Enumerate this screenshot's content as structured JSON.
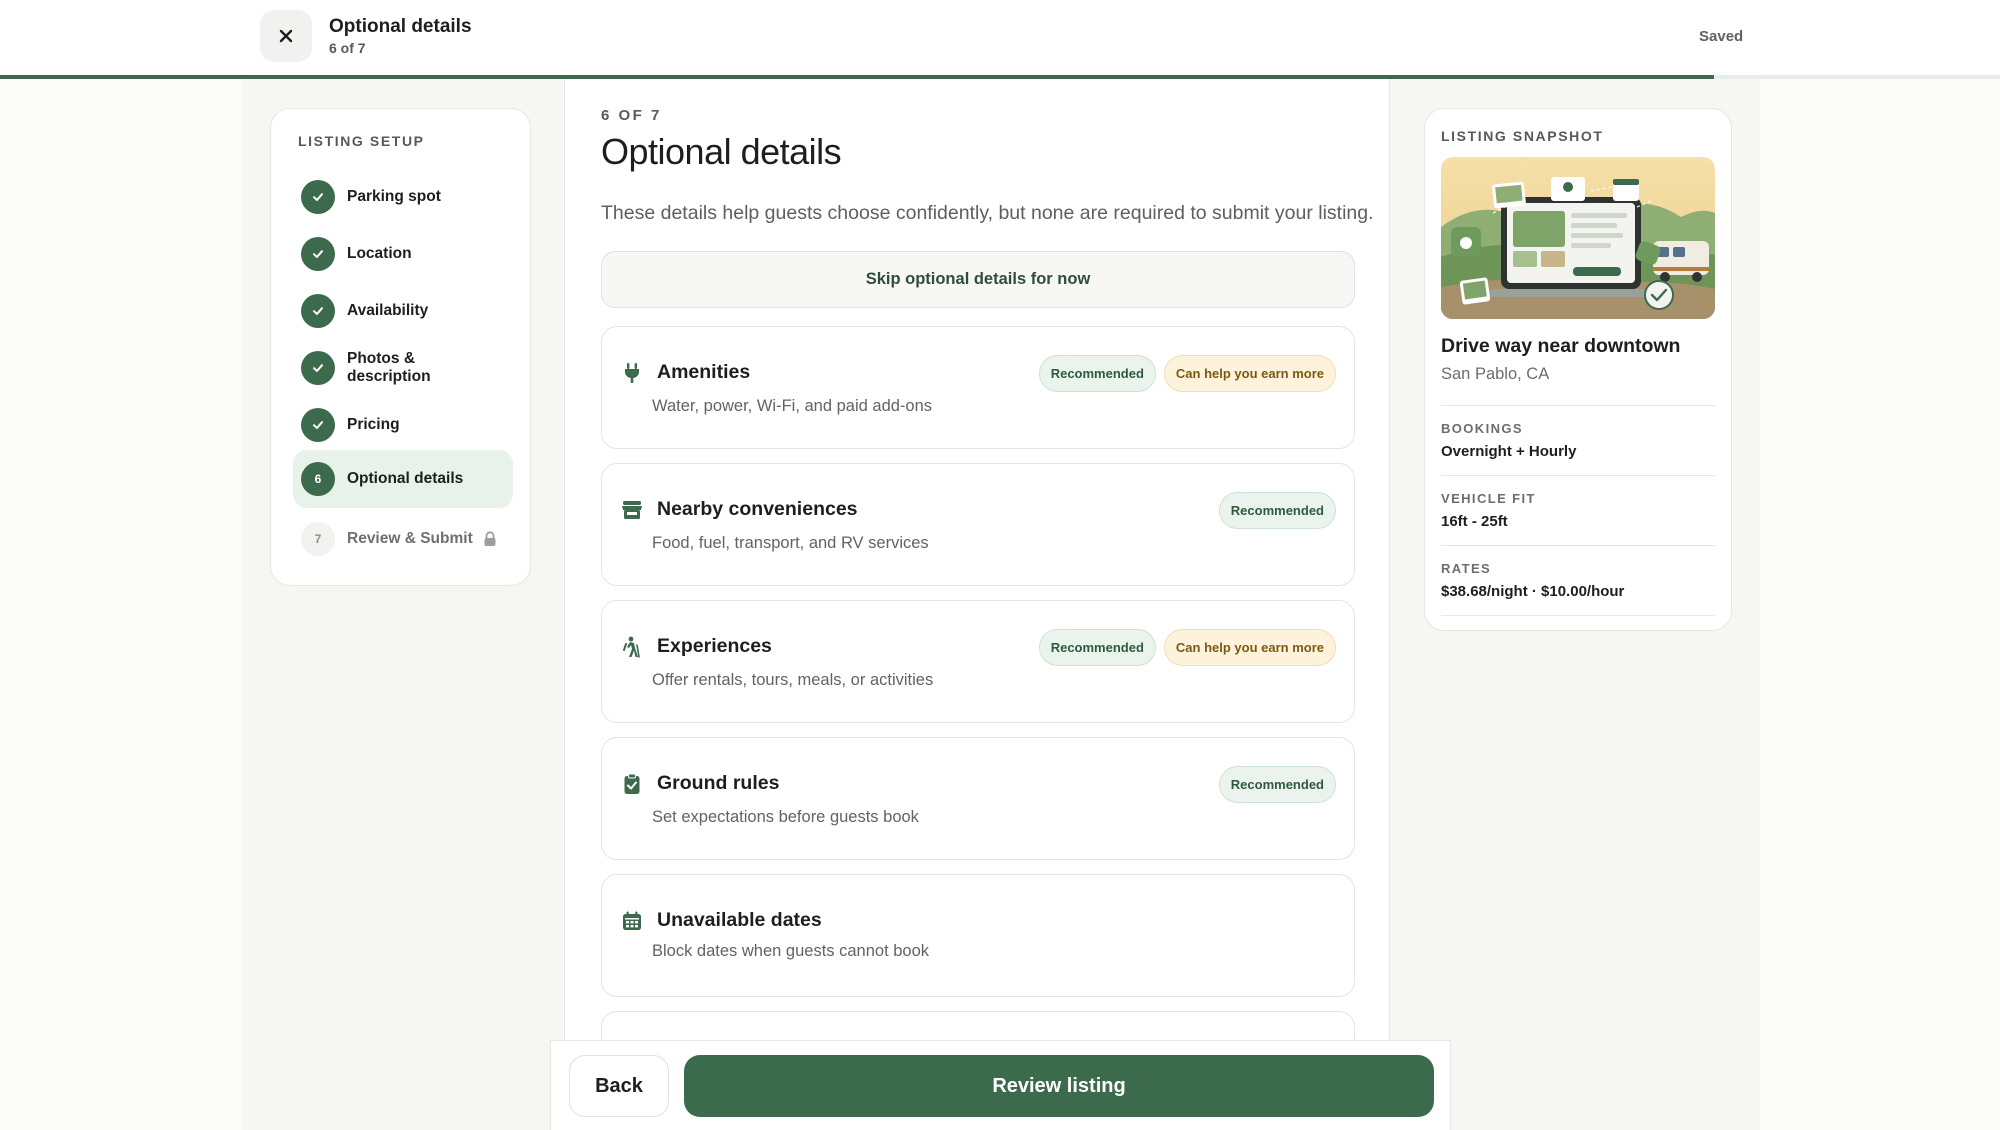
{
  "header": {
    "title": "Optional details",
    "step": "6 of 7",
    "saved": "Saved",
    "progress": 0.857
  },
  "sidebar": {
    "heading": "LISTING SETUP",
    "items": [
      {
        "label": "Parking spot",
        "state": "done"
      },
      {
        "label": "Location",
        "state": "done"
      },
      {
        "label": "Availability",
        "state": "done"
      },
      {
        "label": "Photos & description",
        "state": "done"
      },
      {
        "label": "Pricing",
        "state": "done"
      },
      {
        "label": "Optional details",
        "state": "current",
        "number": "6"
      },
      {
        "label": "Review & Submit",
        "state": "locked",
        "number": "7"
      }
    ]
  },
  "main": {
    "eyebrow": "6 OF 7",
    "title": "Optional details",
    "description": "These details help guests choose confidently, but none are required to submit your listing.",
    "skip_label": "Skip optional details for now",
    "cards": [
      {
        "title": "Amenities",
        "subtitle": "Water, power, Wi-Fi, and paid add-ons",
        "icon": "plug-icon",
        "badges": [
          "Recommended",
          "Can help you earn more"
        ]
      },
      {
        "title": "Nearby conveniences",
        "subtitle": "Food, fuel, transport, and RV services",
        "icon": "store-icon",
        "badges": [
          "Recommended"
        ]
      },
      {
        "title": "Experiences",
        "subtitle": "Offer rentals, tours, meals, or activities",
        "icon": "hiker-icon",
        "badges": [
          "Recommended",
          "Can help you earn more"
        ]
      },
      {
        "title": "Ground rules",
        "subtitle": "Set expectations before guests book",
        "icon": "clipboard-check-icon",
        "badges": [
          "Recommended"
        ]
      },
      {
        "title": "Unavailable dates",
        "subtitle": "Block dates when guests cannot book",
        "icon": "calendar-icon",
        "badges": []
      }
    ]
  },
  "actions": {
    "back": "Back",
    "review": "Review listing"
  },
  "snapshot": {
    "heading": "LISTING SNAPSHOT",
    "title": "Drive way near downtown",
    "location": "San Pablo, CA",
    "bookings_label": "BOOKINGS",
    "bookings_value": "Overnight + Hourly",
    "vehicle_label": "VEHICLE FIT",
    "vehicle_value": "16ft - 25ft",
    "rates_label": "RATES",
    "rates_value": "$38.68/night · $10.00/hour"
  },
  "colors": {
    "accent": "#3c6a4c",
    "recommended_bg": "#eaf3ec",
    "earn_bg": "#fdf3dc"
  }
}
